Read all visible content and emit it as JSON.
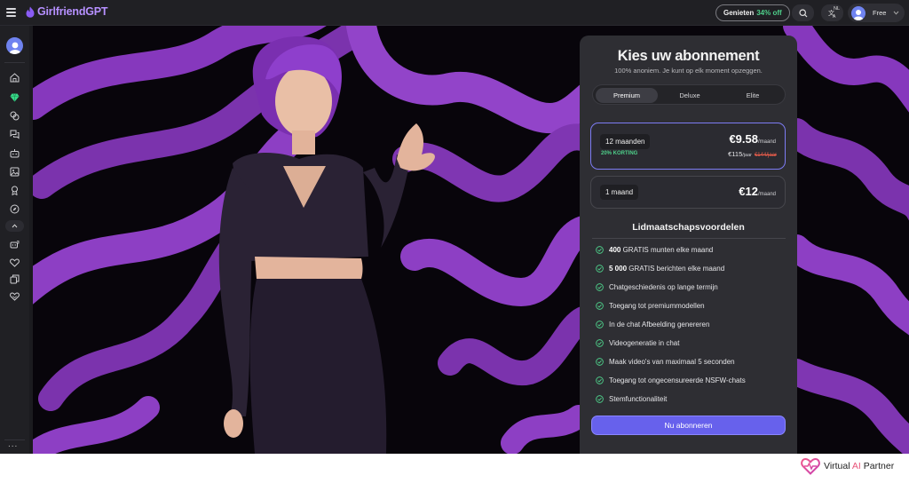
{
  "brand": {
    "name": "GirlfriendGPT",
    "color": "#b690ff"
  },
  "header": {
    "promo_label": "Genieten",
    "promo_percent": "34% off",
    "lang_badge": "NL",
    "user_plan": "Free"
  },
  "sidebar": {
    "icons": [
      "home-icon",
      "gem-icon",
      "chat-bubbles-icon",
      "messages-icon",
      "robot-icon",
      "image-icon",
      "award-icon",
      "compass-icon",
      "chevron-up-icon",
      "bot-chat-icon",
      "heart-icon",
      "copy-icon",
      "heart-outline-icon"
    ],
    "more": "..."
  },
  "panel": {
    "title": "Kies uw abonnement",
    "subtitle": "100% anoniem. Je kunt op elk moment opzeggen.",
    "tabs": [
      {
        "label": "Premium",
        "active": true
      },
      {
        "label": "Deluxe",
        "active": false
      },
      {
        "label": "Elite",
        "active": false
      }
    ],
    "plans": [
      {
        "duration": "12 maanden",
        "discount": "20% KORTING",
        "price": "€9.58",
        "per": "/maand",
        "year_price": "€115",
        "year_unit": "/jaar",
        "old_price": "€144/jaar",
        "selected": true
      },
      {
        "duration": "1 maand",
        "price": "€12",
        "per": "/maand",
        "selected": false
      }
    ],
    "benefits_title": "Lidmaatschapsvoordelen",
    "benefits": [
      {
        "bold": "400",
        "text": " GRATIS munten elke maand"
      },
      {
        "bold": "5 000",
        "text": " GRATIS berichten elke maand"
      },
      {
        "bold": "",
        "text": "Chatgeschiedenis op lange termijn"
      },
      {
        "bold": "",
        "text": "Toegang tot premiummodellen"
      },
      {
        "bold": "",
        "text": "In de chat Afbeelding genereren"
      },
      {
        "bold": "",
        "text": "Videogeneratie in chat"
      },
      {
        "bold": "",
        "text": "Maak video's van maximaal 5 seconden"
      },
      {
        "bold": "",
        "text": "Toegang tot ongecensureerde NSFW-chats"
      },
      {
        "bold": "",
        "text": "Stemfunctionaliteit"
      }
    ],
    "cta": "Nu abonneren"
  },
  "watermark": {
    "prefix": "Virtual ",
    "accent": "AI",
    "suffix": " Partner"
  },
  "colors": {
    "accent": "#6761ec",
    "discount": "#4ecf8a",
    "old_price": "#f25f4c",
    "background_purple": "#8d3fc4"
  }
}
